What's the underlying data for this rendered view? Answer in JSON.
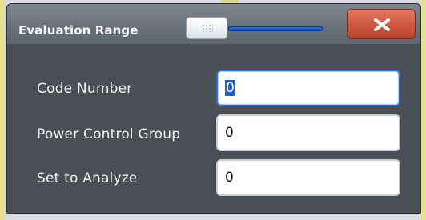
{
  "dialog": {
    "title": "Evaluation Range",
    "close_label": "X"
  },
  "fields": [
    {
      "label": "Code Number",
      "value": "0",
      "focused": true
    },
    {
      "label": "Power Control Group",
      "value": "0",
      "focused": false
    },
    {
      "label": "Set to Analyze",
      "value": "0",
      "focused": false
    }
  ],
  "icons": {
    "close": "close-icon",
    "drag_handle": "window-drag-handle"
  },
  "colors": {
    "dialog_bg": "#4a4f55",
    "titlebar_top": "#7f8790",
    "close_button": "#d05a41",
    "accent_blue": "#2f6fd8"
  }
}
